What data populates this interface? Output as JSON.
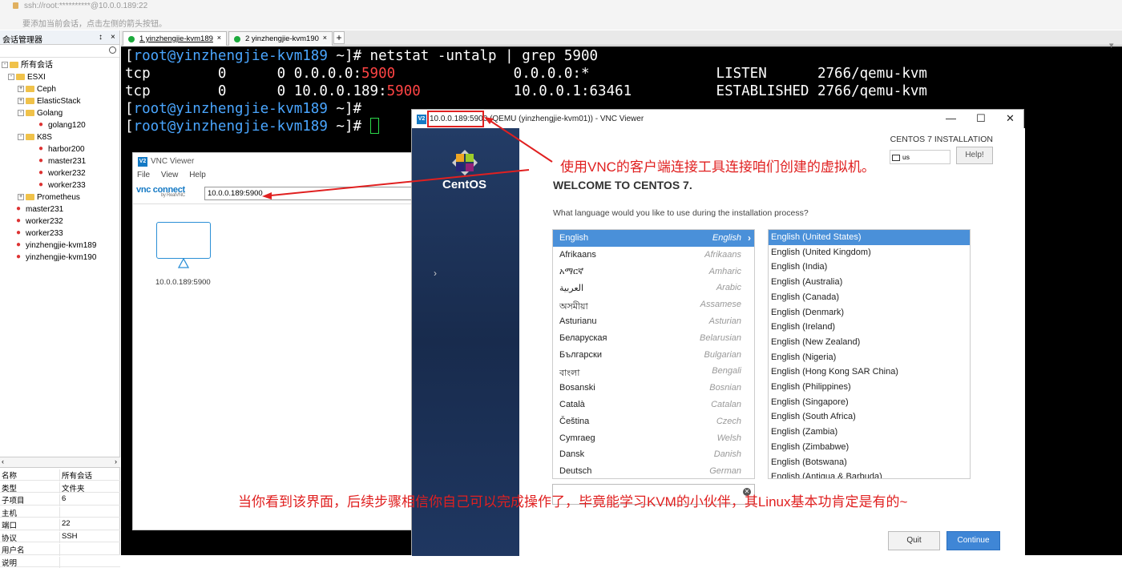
{
  "topbar": {
    "address": "ssh://root:**********@10.0.0.189:22",
    "hint": "要添加当前会话，点击左侧的箭头按钮。"
  },
  "session_manager": {
    "title": "会话管理器",
    "pin": "↕",
    "close": "×",
    "tree": {
      "root": "所有会话",
      "esxi": "ESXI",
      "ceph": "Ceph",
      "elasticstack": "ElasticStack",
      "golang": "Golang",
      "golang120": "golang120",
      "k8s": "K8S",
      "harbor200": "harbor200",
      "master231_k": "master231",
      "worker232_k": "worker232",
      "worker233_k": "worker233",
      "prometheus": "Prometheus",
      "master231": "master231",
      "worker232": "worker232",
      "worker233": "worker233",
      "kvm189": "yinzhengjie-kvm189",
      "kvm190": "yinzhengjie-kvm190"
    },
    "props": [
      {
        "k": "名称",
        "v": "所有会话"
      },
      {
        "k": "类型",
        "v": "文件夹"
      },
      {
        "k": "子项目",
        "v": "6"
      },
      {
        "k": "主机",
        "v": ""
      },
      {
        "k": "端口",
        "v": "22"
      },
      {
        "k": "协议",
        "v": "SSH"
      },
      {
        "k": "用户名",
        "v": ""
      },
      {
        "k": "说明",
        "v": ""
      }
    ]
  },
  "tabs": [
    {
      "label": "1 yinzhengjie-kvm189",
      "close": "×"
    },
    {
      "label": "2 yinzhengjie-kvm190",
      "close": "×"
    }
  ],
  "tab_add": "+",
  "terminal": {
    "l1_open": "[",
    "l1_user": "root@yinzhengjie-kvm189",
    "l1_rest": " ~]# netstat -untalp | grep 5900",
    "l2a": "tcp        0      0 0.0.0.0:",
    "l2b": "5900",
    "l2c": "              0.0.0.0:*               LISTEN      2766/qemu-kvm",
    "l3a": "tcp        0      0 10.0.0.189:",
    "l3b": "5900",
    "l3c": "           10.0.0.1:63461          ESTABLISHED 2766/qemu-kvm",
    "l4_open": "[",
    "l4_user": "root@yinzhengjie-kvm189",
    "l4_rest": " ~]#",
    "l5_open": "[",
    "l5_user": "root@yinzhengjie-kvm189",
    "l5_rest": " ~]# "
  },
  "vnc_small": {
    "badge": "V2",
    "title": "VNC Viewer",
    "menu": [
      "File",
      "View",
      "Help"
    ],
    "logo": "vnc connect",
    "logo_sub": "by RealVNC",
    "address": "10.0.0.189:5900",
    "host_label": "10.0.0.189:5900"
  },
  "vnc_window": {
    "badge": "V2",
    "title_addr": "10.0.0.189:5900",
    "title_rest": " (QEMU (yinzhengjie-kvm01)) - VNC Viewer",
    "minimize": "—",
    "maximize": "☐",
    "close": "✕"
  },
  "centos": {
    "brand": "CentOS",
    "install_title": "CENTOS 7 INSTALLATION",
    "keyboard": "us",
    "help": "Help!",
    "welcome": "WELCOME TO CENTOS 7.",
    "question": "What language would you like to use during the installation process?",
    "languages": [
      {
        "n": "English",
        "e": "English"
      },
      {
        "n": "Afrikaans",
        "e": "Afrikaans"
      },
      {
        "n": "አማርኛ",
        "e": "Amharic"
      },
      {
        "n": "العربية",
        "e": "Arabic"
      },
      {
        "n": "অসমীয়া",
        "e": "Assamese"
      },
      {
        "n": "Asturianu",
        "e": "Asturian"
      },
      {
        "n": "Беларуская",
        "e": "Belarusian"
      },
      {
        "n": "Български",
        "e": "Bulgarian"
      },
      {
        "n": "বাংলা",
        "e": "Bengali"
      },
      {
        "n": "Bosanski",
        "e": "Bosnian"
      },
      {
        "n": "Català",
        "e": "Catalan"
      },
      {
        "n": "Čeština",
        "e": "Czech"
      },
      {
        "n": "Cymraeg",
        "e": "Welsh"
      },
      {
        "n": "Dansk",
        "e": "Danish"
      },
      {
        "n": "Deutsch",
        "e": "German"
      }
    ],
    "locales": [
      "English (United States)",
      "English (United Kingdom)",
      "English (India)",
      "English (Australia)",
      "English (Canada)",
      "English (Denmark)",
      "English (Ireland)",
      "English (New Zealand)",
      "English (Nigeria)",
      "English (Hong Kong SAR China)",
      "English (Philippines)",
      "English (Singapore)",
      "English (South Africa)",
      "English (Zambia)",
      "English (Zimbabwe)",
      "English (Botswana)",
      "English (Antigua & Barbuda)"
    ],
    "search_clear": "✕",
    "quit": "Quit",
    "continue": "Continue"
  },
  "annotations": {
    "a1": "使用VNC的客户端连接工具连接咱们创建的虚拟机。",
    "a2": "当你看到该界面，后续步骤相信你自己可以完成操作了，毕竟能学习KVM的小伙伴，其Linux基本功肯定是有的~"
  },
  "colors": {
    "accent": "#4a90d9",
    "annotation": "#e02020",
    "prompt": "#4aa6ff",
    "port": "#ff4444"
  }
}
